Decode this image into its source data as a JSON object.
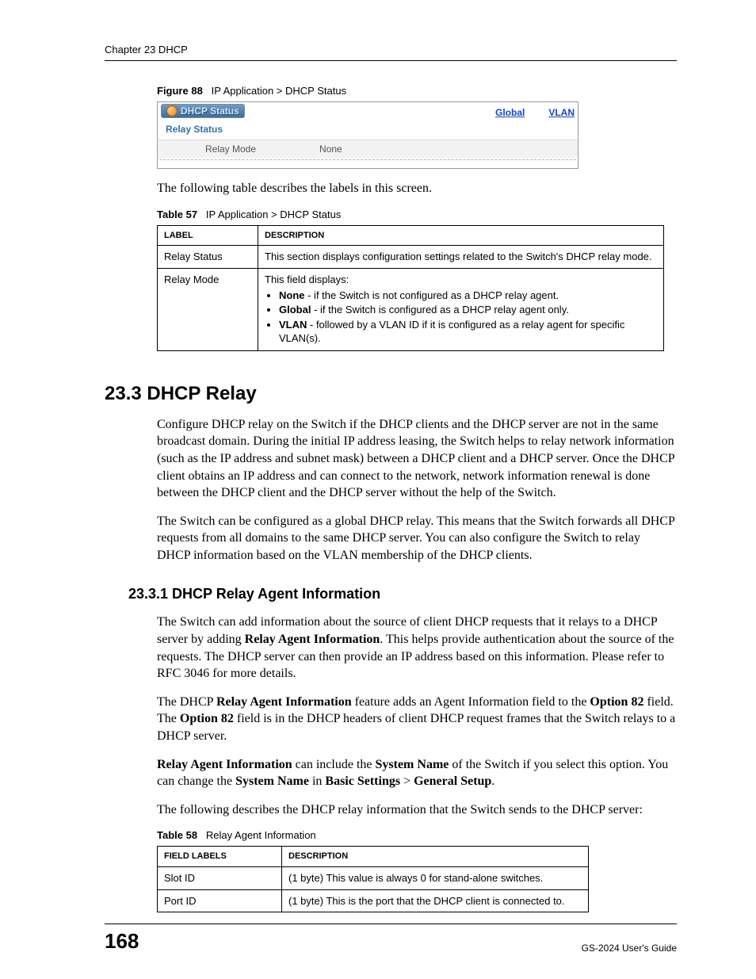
{
  "header": {
    "chapter": "Chapter 23 DHCP"
  },
  "figure88": {
    "caption_num": "Figure 88",
    "caption_text": "IP Application > DHCP Status",
    "tab_title": "DHCP Status",
    "link_global": "Global",
    "link_vlan": "VLAN",
    "section_label": "Relay Status",
    "row_label": "Relay Mode",
    "row_value": "None"
  },
  "intro_line": "The following table describes the labels in this screen.",
  "table57": {
    "caption_num": "Table 57",
    "caption_text": "IP Application > DHCP Status",
    "head_label": "LABEL",
    "head_desc": "DESCRIPTION",
    "rows": [
      {
        "label": "Relay Status",
        "desc": "This section displays configuration settings related to the Switch's DHCP relay mode."
      },
      {
        "label": "Relay Mode",
        "desc_intro": "This field displays:",
        "bullets": [
          {
            "b": "None",
            "t": " - if the Switch is not configured as a DHCP relay agent."
          },
          {
            "b": "Global",
            "t": " - if the Switch is configured as a DHCP relay agent only."
          },
          {
            "b": "VLAN",
            "t": " - followed by a VLAN ID if it is configured as a relay agent for specific VLAN(s)."
          }
        ]
      }
    ]
  },
  "sec23_3": {
    "title": "23.3  DHCP Relay",
    "p1": "Configure DHCP relay on the Switch if the DHCP clients and the DHCP server are not in the same broadcast domain. During the initial IP address leasing, the Switch helps to relay network information (such as the IP address and subnet mask) between a DHCP client and a DHCP server. Once the DHCP client obtains an IP address and can connect to the network, network information renewal is done between the DHCP client and the DHCP server without the help of the Switch.",
    "p2": "The Switch can be configured as a global DHCP relay. This means that the Switch forwards all DHCP requests from all domains to the same DHCP server. You can also configure the Switch to relay DHCP information based on the VLAN membership of the DHCP clients."
  },
  "sec23_3_1": {
    "title": "23.3.1  DHCP Relay Agent Information",
    "p1_a": "The Switch can add information about the source of client DHCP requests that it relays to a DHCP server by adding ",
    "p1_b": "Relay Agent Information",
    "p1_c": ". This helps provide authentication about the source of the requests. The DHCP server can then provide an IP address based on this information. Please refer to RFC 3046 for more details.",
    "p2_a": "The DHCP ",
    "p2_b": "Relay Agent Information",
    "p2_c": " feature adds an Agent Information field to the ",
    "p2_d": "Option 82",
    "p2_e": " field. The ",
    "p2_f": "Option 82",
    "p2_g": " field is in the DHCP headers of client DHCP request frames that the Switch relays to a DHCP server.",
    "p3_a": "Relay Agent Information",
    "p3_b": " can include the ",
    "p3_c": "System Name",
    "p3_d": " of the Switch if you select this option. You can change the ",
    "p3_e": "System Name",
    "p3_f": " in ",
    "p3_g": "Basic Settings",
    "p3_h": " > ",
    "p3_i": "General Setup",
    "p3_j": ".",
    "p4": "The following describes the DHCP relay information that the Switch sends to the DHCP server:"
  },
  "table58": {
    "caption_num": "Table 58",
    "caption_text": "Relay Agent Information",
    "head_label": "FIELD LABELS",
    "head_desc": "DESCRIPTION",
    "rows": [
      {
        "label": "Slot ID",
        "desc": "(1 byte) This value is always 0 for stand-alone switches."
      },
      {
        "label": "Port ID",
        "desc": "(1 byte) This is the port that the DHCP client is connected to."
      }
    ]
  },
  "footer": {
    "page": "168",
    "guide": "GS-2024 User's Guide"
  }
}
